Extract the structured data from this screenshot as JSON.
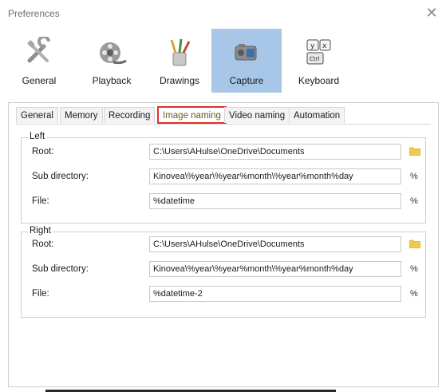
{
  "window": {
    "title": "Preferences"
  },
  "toolbar": {
    "items": [
      {
        "label": "General",
        "icon": "tools-icon"
      },
      {
        "label": "Playback",
        "icon": "film-reel-icon"
      },
      {
        "label": "Drawings",
        "icon": "brushes-icon"
      },
      {
        "label": "Capture",
        "icon": "camera-icon",
        "active": true
      },
      {
        "label": "Keyboard",
        "icon": "keyboard-keys-icon"
      }
    ]
  },
  "tabs": [
    "General",
    "Memory",
    "Recording",
    "Image naming",
    "Video naming",
    "Automation"
  ],
  "selected_tab": "Image naming",
  "left": {
    "group_label": "Left",
    "root_label": "Root:",
    "root_value": "C:\\Users\\AHulse\\OneDrive\\Documents",
    "subdir_label": "Sub directory:",
    "subdir_value": "Kinovea\\%year\\%year%month\\%year%month%day",
    "file_label": "File:",
    "file_value": "%datetime"
  },
  "right": {
    "group_label": "Right",
    "root_label": "Root:",
    "root_value": "C:\\Users\\AHulse\\OneDrive\\Documents",
    "subdir_label": "Sub directory:",
    "subdir_value": "Kinovea\\%year\\%year%month\\%year%month%day",
    "file_label": "File:",
    "file_value": "%datetime-2"
  },
  "macro_symbol": "%",
  "colors": {
    "accent": "#a8c6e8",
    "tab_highlight": "#e03030",
    "folder": "#f2c94c"
  }
}
